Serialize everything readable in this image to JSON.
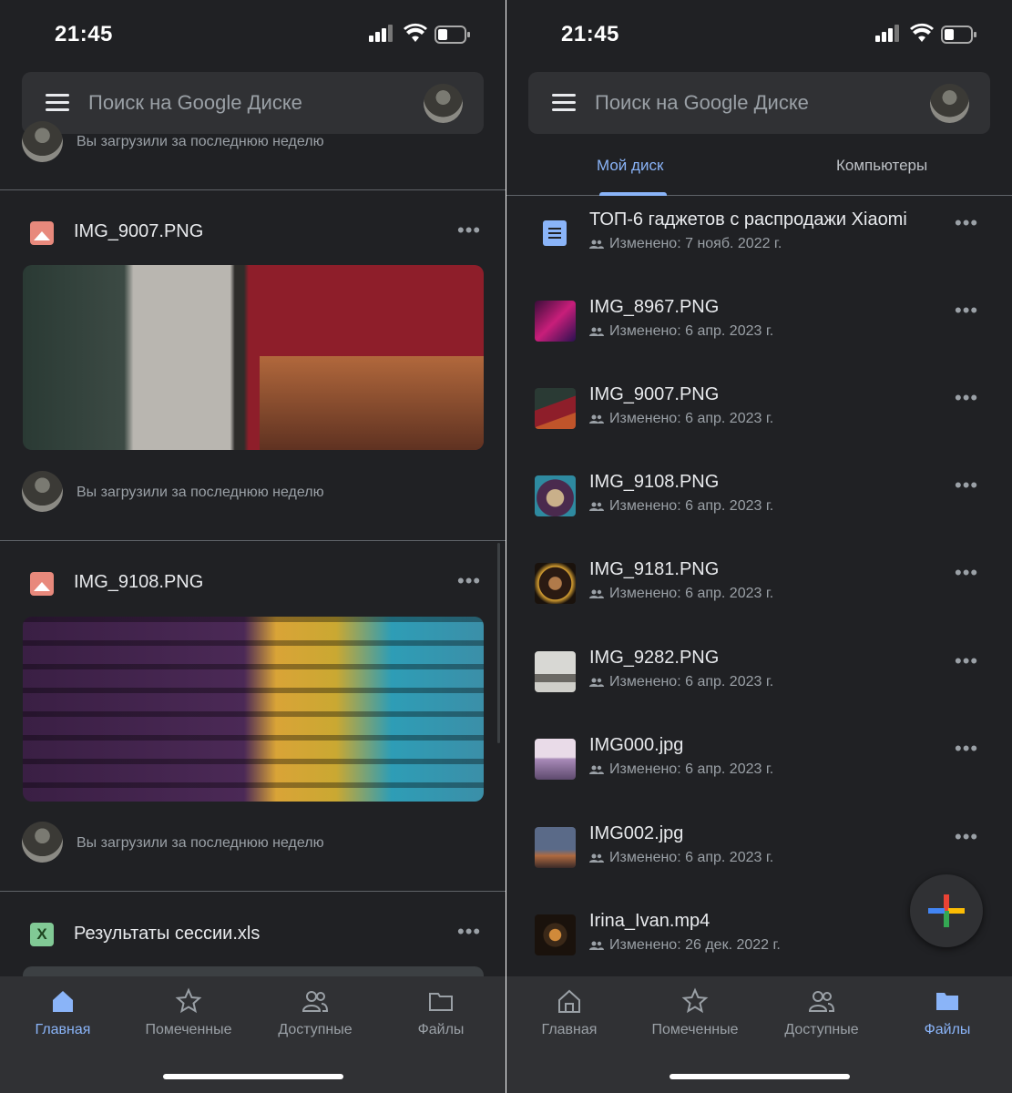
{
  "left": {
    "status": {
      "time": "21:45"
    },
    "search": {
      "placeholder": "Поиск на Google Диске"
    },
    "top_partial_caption": "Вы загрузили за последнюю неделю",
    "feed": [
      {
        "title": "IMG_9007.PNG",
        "caption": "Вы загрузили за последнюю неделю",
        "icon": "image-icon"
      },
      {
        "title": "IMG_9108.PNG",
        "caption": "Вы загрузили за последнюю неделю",
        "icon": "image-icon"
      },
      {
        "title": "Результаты сессии.xls",
        "icon": "sheets-icon",
        "icon_letter": "X"
      }
    ],
    "nav": [
      {
        "label": "Главная",
        "icon": "home-icon",
        "active": true
      },
      {
        "label": "Помеченные",
        "icon": "star-icon",
        "active": false
      },
      {
        "label": "Доступные",
        "icon": "people-icon",
        "active": false
      },
      {
        "label": "Файлы",
        "icon": "folder-icon",
        "active": false
      }
    ]
  },
  "right": {
    "status": {
      "time": "21:45"
    },
    "search": {
      "placeholder": "Поиск на Google Диске"
    },
    "tabs": [
      {
        "label": "Мой диск",
        "active": true
      },
      {
        "label": "Компьютеры",
        "active": false
      }
    ],
    "files": [
      {
        "name": "ТОП-6 гаджетов с распродажи Xiaomi",
        "meta": "Изменено: 7 нояб. 2022 г.",
        "icon": "docs-icon"
      },
      {
        "name": "IMG_8967.PNG",
        "meta": "Изменено: 6 апр. 2023 г.",
        "icon": "thumbnail"
      },
      {
        "name": "IMG_9007.PNG",
        "meta": "Изменено: 6 апр. 2023 г.",
        "icon": "thumbnail"
      },
      {
        "name": "IMG_9108.PNG",
        "meta": "Изменено: 6 апр. 2023 г.",
        "icon": "thumbnail"
      },
      {
        "name": "IMG_9181.PNG",
        "meta": "Изменено: 6 апр. 2023 г.",
        "icon": "thumbnail"
      },
      {
        "name": "IMG_9282.PNG",
        "meta": "Изменено: 6 апр. 2023 г.",
        "icon": "thumbnail"
      },
      {
        "name": "IMG000.jpg",
        "meta": "Изменено: 6 апр. 2023 г.",
        "icon": "thumbnail"
      },
      {
        "name": "IMG002.jpg",
        "meta": "Изменено: 6 апр. 2023 г.",
        "icon": "thumbnail"
      },
      {
        "name": "Irina_Ivan.mp4",
        "meta": "Изменено: 26 дек. 2022 г.",
        "icon": "video-thumbnail"
      }
    ],
    "nav": [
      {
        "label": "Главная",
        "icon": "home-icon",
        "active": false
      },
      {
        "label": "Помеченные",
        "icon": "star-icon",
        "active": false
      },
      {
        "label": "Доступные",
        "icon": "people-icon",
        "active": false
      },
      {
        "label": "Файлы",
        "icon": "folder-icon",
        "active": true
      }
    ]
  },
  "colors": {
    "background": "#202124",
    "surface": "#303134",
    "accent": "#8ab4f8",
    "text": "#e8eaed",
    "muted": "#9aa0a6"
  }
}
